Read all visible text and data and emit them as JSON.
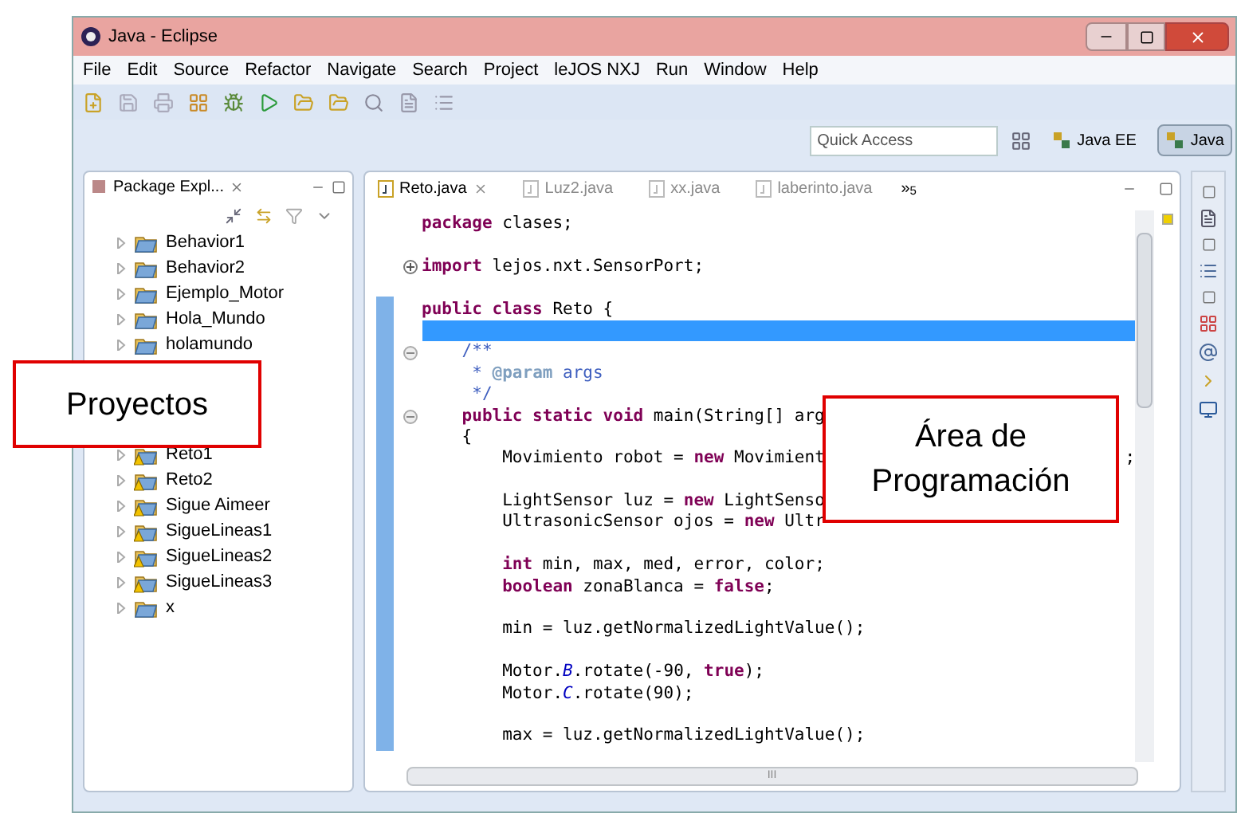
{
  "window": {
    "title": "Java - Eclipse"
  },
  "menu": [
    "File",
    "Edit",
    "Source",
    "Refactor",
    "Navigate",
    "Search",
    "Project",
    "leJOS NXJ",
    "Run",
    "Window",
    "Help"
  ],
  "quick_access": {
    "placeholder": "Quick Access"
  },
  "perspectives": [
    {
      "label": "Java EE",
      "selected": false
    },
    {
      "label": "Java",
      "selected": true
    }
  ],
  "package_explorer": {
    "title": "Package Expl...",
    "items_top": [
      {
        "label": "Behavior1",
        "warning": false,
        "expanded": false
      },
      {
        "label": "Behavior2",
        "warning": false,
        "expanded": false
      },
      {
        "label": "Ejemplo_Motor",
        "warning": false,
        "expanded": false
      },
      {
        "label": "Hola_Mundo",
        "warning": false,
        "expanded": false
      },
      {
        "label": "holamundo",
        "warning": false,
        "expanded": false
      }
    ],
    "items_bottom": [
      {
        "label": "Reto1",
        "warning": true,
        "expanded": false
      },
      {
        "label": "Reto2",
        "warning": true,
        "expanded": false
      },
      {
        "label": "Sigue Aimeer",
        "warning": true,
        "expanded": false
      },
      {
        "label": "SigueLineas1",
        "warning": true,
        "expanded": false
      },
      {
        "label": "SigueLineas2",
        "warning": true,
        "expanded": false
      },
      {
        "label": "SigueLineas3",
        "warning": true,
        "expanded": false
      },
      {
        "label": "x",
        "warning": false,
        "expanded": false
      }
    ]
  },
  "editor": {
    "tabs": [
      {
        "label": "Reto.java",
        "selected": true
      },
      {
        "label": "Luz2.java",
        "selected": false
      },
      {
        "label": "xx.java",
        "selected": false
      },
      {
        "label": "laberinto.java",
        "selected": false
      }
    ],
    "overflow": "»$_{5}$",
    "lines": [
      {
        "highlighted": false,
        "segments": [
          {
            "kind": "kw",
            "text": "package"
          },
          {
            "kind": "plain",
            "text": " clases;"
          }
        ]
      },
      {
        "highlighted": false
      },
      {
        "highlighted": false,
        "folded": true,
        "segments": [
          {
            "kind": "kw",
            "text": "import"
          },
          {
            "kind": "plain",
            "text": " lejos.nxt.SensorPort;"
          }
        ]
      },
      {
        "highlighted": false
      },
      {
        "highlighted": false,
        "segments": [
          {
            "kind": "kw",
            "text": "public class"
          },
          {
            "kind": "plain",
            "text": " Reto {"
          }
        ]
      },
      {
        "highlighted": true
      },
      {
        "highlighted": false,
        "folded": false,
        "segments": [
          {
            "kind": "comment",
            "text": "    /**"
          }
        ]
      },
      {
        "highlighted": false,
        "segments": [
          {
            "kind": "comment",
            "text": "     * "
          },
          {
            "kind": "doctag",
            "text": "@param"
          },
          {
            "kind": "comment",
            "text": " args"
          }
        ]
      },
      {
        "highlighted": false,
        "segments": [
          {
            "kind": "comment",
            "text": "     */"
          }
        ]
      },
      {
        "highlighted": false,
        "folded": false,
        "segments": [
          {
            "kind": "kw",
            "text": "    public static void"
          },
          {
            "kind": "plain",
            "text": " main(String[] arg"
          }
        ]
      },
      {
        "highlighted": false,
        "segments": [
          {
            "kind": "plain",
            "text": "    {"
          }
        ]
      },
      {
        "highlighted": false,
        "tail": ";",
        "segments": [
          {
            "kind": "plain",
            "text": "        Movimiento robot = "
          },
          {
            "kind": "kw",
            "text": "new"
          },
          {
            "kind": "plain",
            "text": " Movimient"
          }
        ]
      },
      {
        "highlighted": false
      },
      {
        "highlighted": false,
        "segments": [
          {
            "kind": "plain",
            "text": "        LightSensor luz = "
          },
          {
            "kind": "kw",
            "text": "new"
          },
          {
            "kind": "plain",
            "text": " LightSenso"
          }
        ]
      },
      {
        "highlighted": false,
        "segments": [
          {
            "kind": "plain",
            "text": "        UltrasonicSensor ojos = "
          },
          {
            "kind": "kw",
            "text": "new"
          },
          {
            "kind": "plain",
            "text": " Ultr"
          }
        ]
      },
      {
        "highlighted": false
      },
      {
        "highlighted": false,
        "segments": [
          {
            "kind": "kw",
            "text": "        int"
          },
          {
            "kind": "plain",
            "text": " min, max, med, error, color;"
          }
        ]
      },
      {
        "highlighted": false,
        "segments": [
          {
            "kind": "kw",
            "text": "        boolean"
          },
          {
            "kind": "plain",
            "text": " zonaBlanca = "
          },
          {
            "kind": "kw",
            "text": "false"
          },
          {
            "kind": "plain",
            "text": ";"
          }
        ]
      },
      {
        "highlighted": false
      },
      {
        "highlighted": false,
        "segments": [
          {
            "kind": "plain",
            "text": "        min = luz.getNormalizedLightValue();"
          }
        ]
      },
      {
        "highlighted": false
      },
      {
        "highlighted": false,
        "segments": [
          {
            "kind": "plain",
            "text": "        Motor."
          },
          {
            "kind": "field",
            "text": "B"
          },
          {
            "kind": "plain",
            "text": ".rotate(-90, "
          },
          {
            "kind": "kw",
            "text": "true"
          },
          {
            "kind": "plain",
            "text": ");"
          }
        ]
      },
      {
        "highlighted": false,
        "segments": [
          {
            "kind": "plain",
            "text": "        Motor."
          },
          {
            "kind": "field",
            "text": "C"
          },
          {
            "kind": "plain",
            "text": ".rotate(90);"
          }
        ]
      },
      {
        "highlighted": false
      },
      {
        "highlighted": false,
        "segments": [
          {
            "kind": "plain",
            "text": "        max = luz.getNormalizedLightValue();"
          }
        ]
      }
    ],
    "scrollbar_label": "III"
  },
  "callouts": [
    {
      "kind": "projects",
      "text": "Proyectos"
    },
    {
      "kind": "editor",
      "text": "Área de Programación"
    }
  ]
}
